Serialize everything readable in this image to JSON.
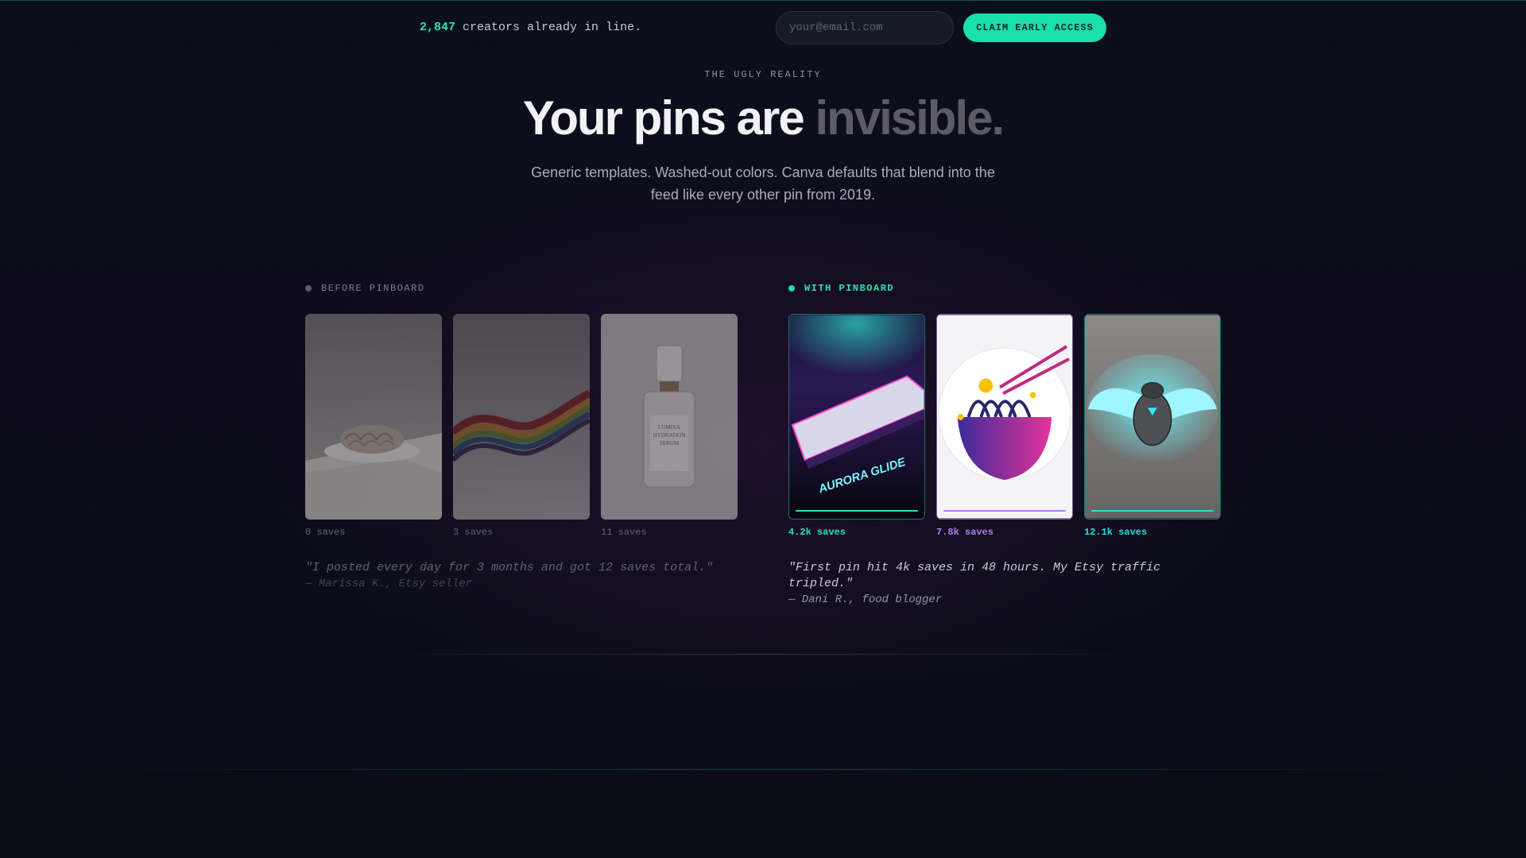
{
  "topbar": {
    "waitlist_count": "2,847",
    "waitlist_text": "creators already in line.",
    "email_placeholder": "your@email.com",
    "cta_label": "CLAIM EARLY ACCESS"
  },
  "hero": {
    "eyebrow": "THE UGLY REALITY",
    "headline_main": "Your pins are ",
    "headline_dim": "invisible.",
    "subtitle": "Generic templates. Washed-out colors. Canva defaults that blend into the feed like every other pin from 2019."
  },
  "before": {
    "label": "BEFORE PINBOARD",
    "pins": [
      {
        "image": "plate-of-noodles",
        "saves": "0 saves"
      },
      {
        "image": "rainbow-glass-wave",
        "saves": "3 saves"
      },
      {
        "image": "serum-bottle",
        "saves": "11 saves",
        "text": [
          "LUMINA",
          "HYDRATION",
          "SERUM"
        ]
      }
    ],
    "quote": "\"I posted every day for 3 months and got 12 saves total.\"",
    "attribution": "— Marissa K., Etsy seller"
  },
  "after": {
    "label": "WITH PINBOARD",
    "pins": [
      {
        "image": "neon-keyboard",
        "saves": "4.2k saves",
        "color": "#2fe0b0",
        "text": "AURORA GLIDE"
      },
      {
        "image": "ramen-bowl-sticker",
        "saves": "7.8k saves",
        "color": "#b57cf2"
      },
      {
        "image": "glowing-scarab",
        "saves": "12.1k saves",
        "color": "#2fd9e0"
      }
    ],
    "quote": "\"First pin hit 4k saves in 48 hours. My Etsy traffic tripled.\"",
    "attribution": "— Dani R., food blogger"
  },
  "colors": {
    "accent": "#19e0ad",
    "background": "#0b0d17"
  }
}
